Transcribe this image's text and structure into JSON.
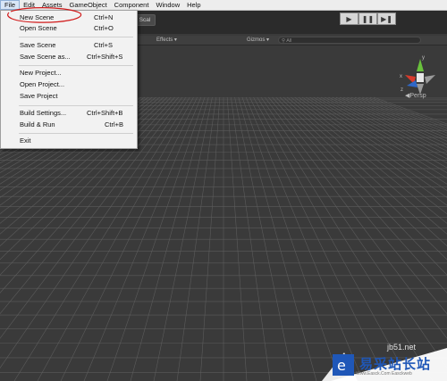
{
  "menubar": {
    "items": [
      "File",
      "Edit",
      "Assets",
      "GameObject",
      "Component",
      "Window",
      "Help"
    ]
  },
  "file_menu": {
    "items": [
      {
        "label": "New Scene",
        "shortcut": "Ctrl+N"
      },
      {
        "label": "Open Scene",
        "shortcut": "Ctrl+O"
      },
      {
        "label": "Save Scene",
        "shortcut": "Ctrl+S"
      },
      {
        "label": "Save Scene as...",
        "shortcut": "Ctrl+Shift+S"
      },
      {
        "label": "New Project...",
        "shortcut": ""
      },
      {
        "label": "Open Project...",
        "shortcut": ""
      },
      {
        "label": "Save Project",
        "shortcut": ""
      },
      {
        "label": "Build Settings...",
        "shortcut": "Ctrl+Shift+B"
      },
      {
        "label": "Build & Run",
        "shortcut": "Ctrl+B"
      },
      {
        "label": "Exit",
        "shortcut": ""
      }
    ]
  },
  "toolbar": {
    "scale_tab": "Scal"
  },
  "scene_bar": {
    "effects": "Effects",
    "gizmos": "Gizmos",
    "search": "All"
  },
  "viewport": {
    "view_mode": "Persp",
    "axis_labels": {
      "y": "y",
      "x": "x",
      "z": "z"
    }
  },
  "watermark": {
    "url": "jb51.net",
    "site_name": "易采站长站",
    "subtitle": "Www.Easck.Com Easckweb"
  },
  "colors": {
    "annotation_circle": "#d11a1a",
    "grid": "#5f5f5f",
    "viewport_bg": "#3a3a3a"
  }
}
